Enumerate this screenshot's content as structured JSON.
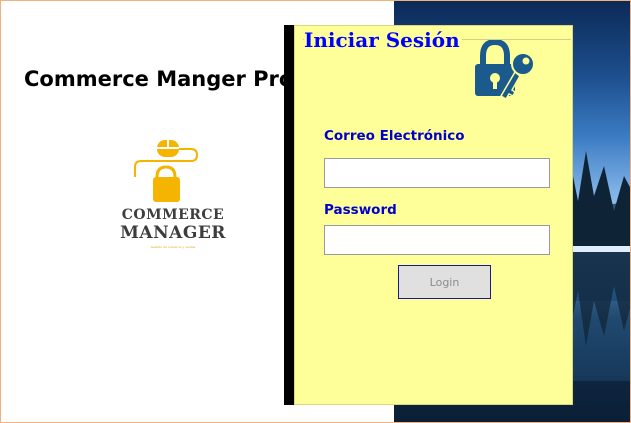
{
  "app": {
    "title": "Commerce Manger Pro"
  },
  "logo": {
    "line1": "COMMERCE",
    "line2": "MANAGER",
    "tagline": "Gestión de comercio y ventas",
    "accent_color": "#f5b400",
    "text_color": "#3d3d3d"
  },
  "login": {
    "title": "Iniciar Sesión",
    "email_label": "Correo Electrónico",
    "email_value": "",
    "password_label": "Password",
    "password_value": "",
    "button_label": "Login",
    "icon": "lock-and-key-icon",
    "panel_color": "#ffff99",
    "title_color": "#0000ff",
    "label_color": "#0000cc",
    "icon_color": "#1a5a8c"
  }
}
